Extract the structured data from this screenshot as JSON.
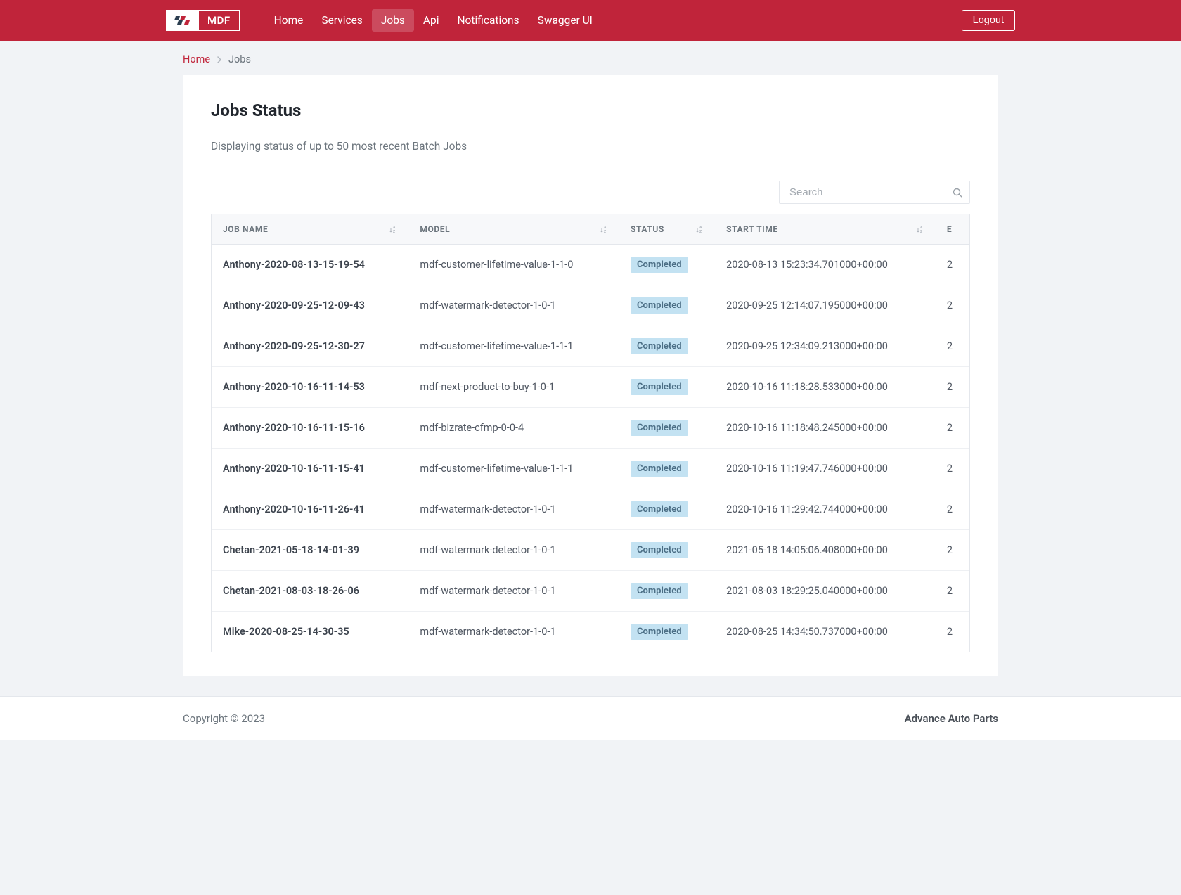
{
  "brand": {
    "short": "MDF"
  },
  "nav": {
    "items": [
      {
        "label": "Home",
        "active": false
      },
      {
        "label": "Services",
        "active": false
      },
      {
        "label": "Jobs",
        "active": true
      },
      {
        "label": "Api",
        "active": false
      },
      {
        "label": "Notifications",
        "active": false
      },
      {
        "label": "Swagger UI",
        "active": false
      }
    ],
    "logout": "Logout"
  },
  "breadcrumb": {
    "home": "Home",
    "current": "Jobs"
  },
  "page": {
    "title": "Jobs Status",
    "subtitle": "Displaying status of up to 50 most recent Batch Jobs"
  },
  "search": {
    "placeholder": "Search",
    "value": ""
  },
  "table": {
    "headers": {
      "job_name": "JOB NAME",
      "model": "MODEL",
      "status": "STATUS",
      "start_time": "START TIME",
      "end_time": "E"
    },
    "rows": [
      {
        "job_name": "Anthony-2020-08-13-15-19-54",
        "model": "mdf-customer-lifetime-value-1-1-0",
        "status": "Completed",
        "start_time": "2020-08-13 15:23:34.701000+00:00",
        "end_partial": "2"
      },
      {
        "job_name": "Anthony-2020-09-25-12-09-43",
        "model": "mdf-watermark-detector-1-0-1",
        "status": "Completed",
        "start_time": "2020-09-25 12:14:07.195000+00:00",
        "end_partial": "2"
      },
      {
        "job_name": "Anthony-2020-09-25-12-30-27",
        "model": "mdf-customer-lifetime-value-1-1-1",
        "status": "Completed",
        "start_time": "2020-09-25 12:34:09.213000+00:00",
        "end_partial": "2"
      },
      {
        "job_name": "Anthony-2020-10-16-11-14-53",
        "model": "mdf-next-product-to-buy-1-0-1",
        "status": "Completed",
        "start_time": "2020-10-16 11:18:28.533000+00:00",
        "end_partial": "2"
      },
      {
        "job_name": "Anthony-2020-10-16-11-15-16",
        "model": "mdf-bizrate-cfmp-0-0-4",
        "status": "Completed",
        "start_time": "2020-10-16 11:18:48.245000+00:00",
        "end_partial": "2"
      },
      {
        "job_name": "Anthony-2020-10-16-11-15-41",
        "model": "mdf-customer-lifetime-value-1-1-1",
        "status": "Completed",
        "start_time": "2020-10-16 11:19:47.746000+00:00",
        "end_partial": "2"
      },
      {
        "job_name": "Anthony-2020-10-16-11-26-41",
        "model": "mdf-watermark-detector-1-0-1",
        "status": "Completed",
        "start_time": "2020-10-16 11:29:42.744000+00:00",
        "end_partial": "2"
      },
      {
        "job_name": "Chetan-2021-05-18-14-01-39",
        "model": "mdf-watermark-detector-1-0-1",
        "status": "Completed",
        "start_time": "2021-05-18 14:05:06.408000+00:00",
        "end_partial": "2"
      },
      {
        "job_name": "Chetan-2021-08-03-18-26-06",
        "model": "mdf-watermark-detector-1-0-1",
        "status": "Completed",
        "start_time": "2021-08-03 18:29:25.040000+00:00",
        "end_partial": "2"
      },
      {
        "job_name": "Mike-2020-08-25-14-30-35",
        "model": "mdf-watermark-detector-1-0-1",
        "status": "Completed",
        "start_time": "2020-08-25 14:34:50.737000+00:00",
        "end_partial": "2"
      }
    ]
  },
  "footer": {
    "copyright": "Copyright © 2023",
    "company": "Advance Auto Parts"
  }
}
